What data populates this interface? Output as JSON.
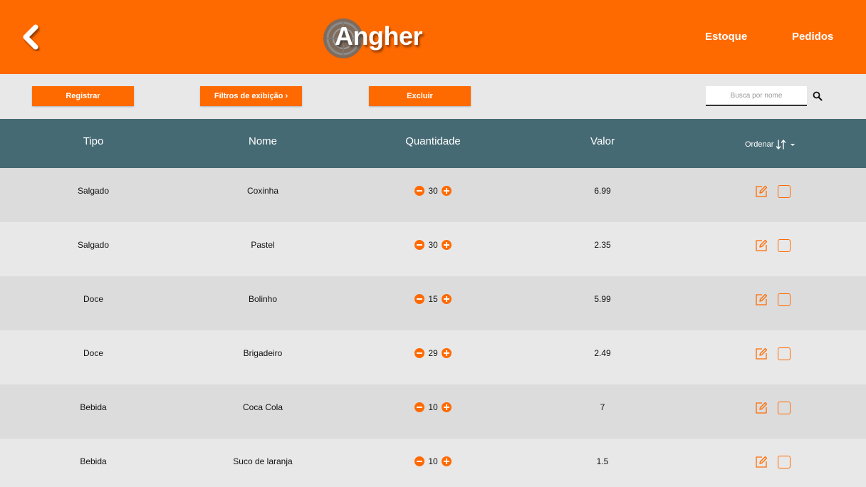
{
  "header": {
    "logo_text": "Angher",
    "nav": {
      "estoque": "Estoque",
      "pedidos": "Pedidos"
    }
  },
  "toolbar": {
    "registrar": "Registrar",
    "filtros": "Filtros de exibição ›",
    "excluir": "Excluir",
    "search_placeholder": "Busca por nome",
    "search_value": ""
  },
  "table": {
    "headers": {
      "tipo": "Tipo",
      "nome": "Nome",
      "quantidade": "Quantidade",
      "valor": "Valor",
      "ordenar": "Ordenar"
    },
    "rows": [
      {
        "tipo": "Salgado",
        "nome": "Coxinha",
        "quantidade": "30",
        "valor": "6.99"
      },
      {
        "tipo": "Salgado",
        "nome": "Pastel",
        "quantidade": "30",
        "valor": "2.35"
      },
      {
        "tipo": "Doce",
        "nome": "Bolinho",
        "quantidade": "15",
        "valor": "5.99"
      },
      {
        "tipo": "Doce",
        "nome": "Brigadeiro",
        "quantidade": "29",
        "valor": "2.49"
      },
      {
        "tipo": "Bebida",
        "nome": "Coca Cola",
        "quantidade": "10",
        "valor": "7"
      },
      {
        "tipo": "Bebida",
        "nome": "Suco de laranja",
        "quantidade": "10",
        "valor": "1.5"
      }
    ]
  },
  "colors": {
    "accent": "#ff6a00",
    "table_header": "#466a74",
    "row_dark": "#dcdcdc",
    "row_light": "#e8e8e8"
  },
  "icons": [
    "back-arrow-icon",
    "search-icon",
    "sort-icon",
    "caret-down-icon",
    "edit-icon",
    "checkbox",
    "minus-icon",
    "plus-icon"
  ]
}
